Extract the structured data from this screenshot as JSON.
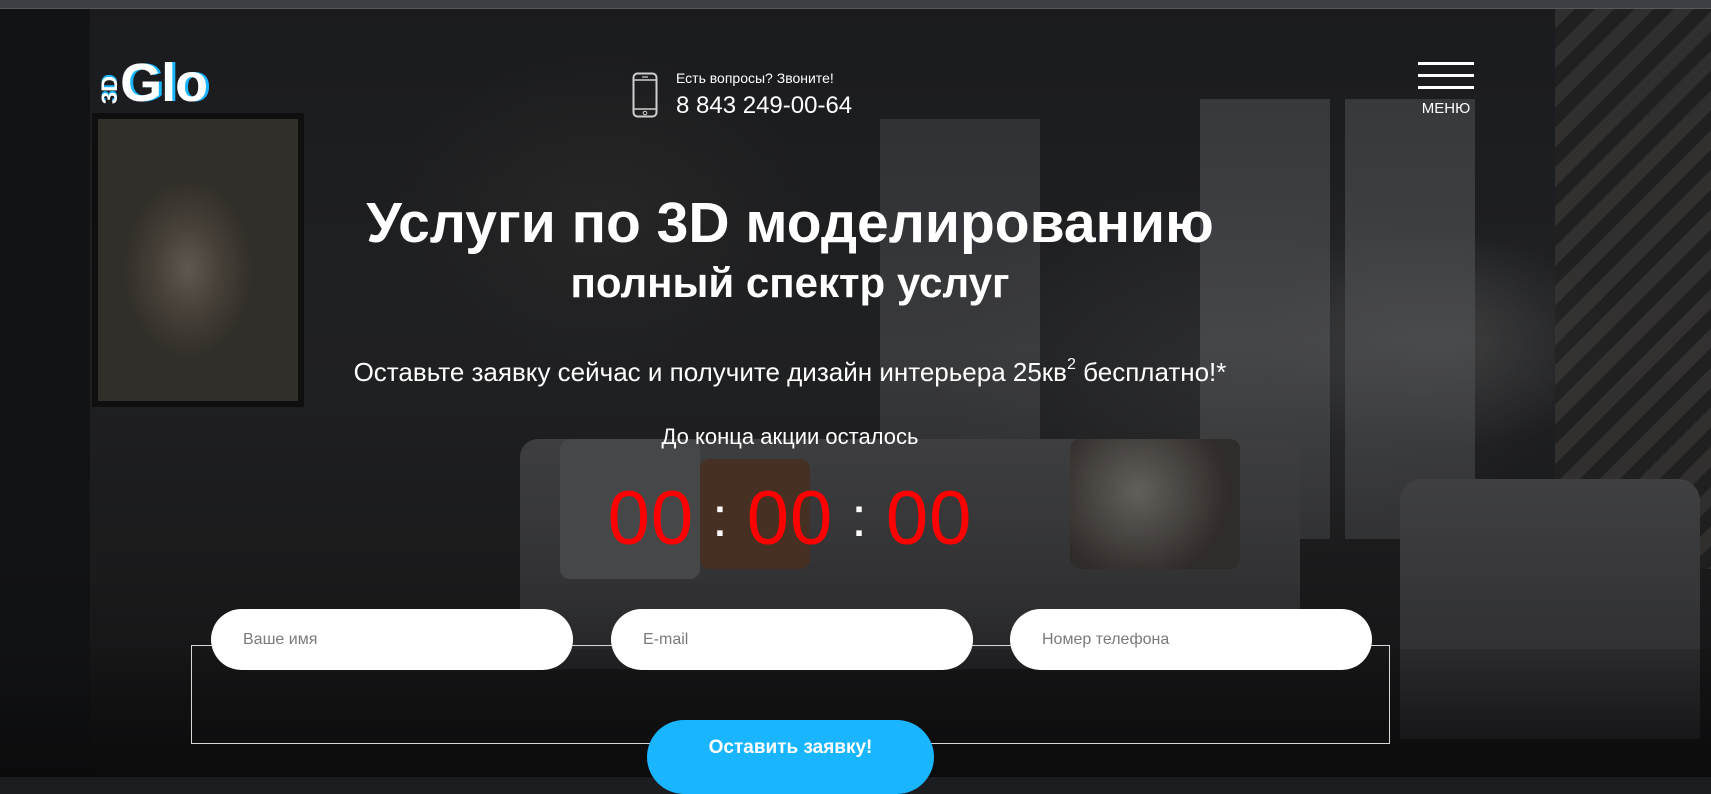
{
  "header": {
    "logo_prefix": "3D",
    "logo_name": "Glo",
    "phone_question": "Есть вопросы? Звоните!",
    "phone_number": "8 843 249-00-64",
    "menu_label": "МЕНЮ"
  },
  "hero": {
    "title": "Услуги по 3D моделированию",
    "subtitle": "полный спектр услуг",
    "offer_text": "Оставьте заявку сейчас и получите дизайн интерьера 25кв",
    "offer_superscript": "2",
    "offer_suffix": " бесплатно!*",
    "timer_label": "До конца акции осталось",
    "timer": {
      "hours": "00",
      "minutes": "00",
      "seconds": "00",
      "separator": ":"
    }
  },
  "form": {
    "name_placeholder": "Ваше имя",
    "email_placeholder": "E-mail",
    "phone_placeholder": "Номер телефона",
    "submit_label": "Оставить заявку!"
  },
  "colors": {
    "accent": "#19b5fe",
    "timer": "#ff0000"
  }
}
